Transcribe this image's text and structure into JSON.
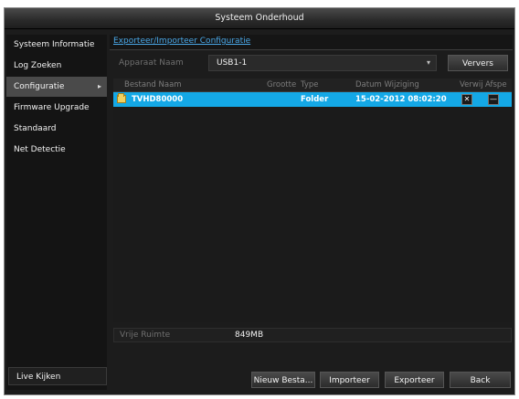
{
  "window": {
    "title": "Systeem Onderhoud"
  },
  "sidebar": {
    "items": [
      {
        "label": "Systeem Informatie",
        "active": false
      },
      {
        "label": "Log Zoeken",
        "active": false
      },
      {
        "label": "Configuratie",
        "active": true,
        "chevron": "▸"
      },
      {
        "label": "Firmware Upgrade",
        "active": false
      },
      {
        "label": "Standaard",
        "active": false
      },
      {
        "label": "Net Detectie",
        "active": false
      }
    ],
    "bottom_label": "Live Kijken"
  },
  "main": {
    "tab_label": "Exporteer/Importeer Configuratie",
    "device": {
      "label": "Apparaat Naam",
      "value": "USB1-1",
      "dropdown_glyph": "▾",
      "refresh_label": "Ververs"
    },
    "table": {
      "headers": {
        "name": "Bestand Naam",
        "size": "Grootte",
        "type": "Type",
        "date": "Datum Wijziging",
        "delete": "Verwij",
        "play": "Afspe"
      },
      "rows": [
        {
          "name": "TVHD80000",
          "size": "",
          "type": "Folder",
          "date": "15-02-2012 08:02:20",
          "delete_glyph": "✕",
          "play_glyph": "—",
          "selected": true
        }
      ]
    },
    "free_space": {
      "label": "Vrije Ruimte",
      "value": "849MB"
    }
  },
  "footer": {
    "new_label": "Nieuw Besta...",
    "import_label": "Importeer",
    "export_label": "Exporteer",
    "back_label": "Back"
  },
  "colors": {
    "selection": "#14a8e6",
    "link": "#4aa8e8",
    "folder": "#f0d060"
  },
  "icons": [
    "folder-icon",
    "dropdown-arrow-icon",
    "chevron-right-icon",
    "delete-icon",
    "play-icon"
  ]
}
